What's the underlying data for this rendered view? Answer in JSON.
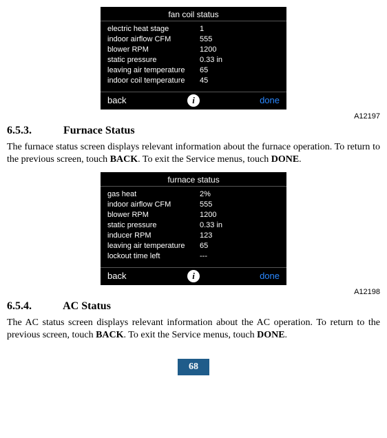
{
  "figure1": {
    "title": "fan coil status",
    "rows": [
      {
        "label": "electric heat stage",
        "value": "1"
      },
      {
        "label": "indoor airflow CFM",
        "value": "555"
      },
      {
        "label": "blower RPM",
        "value": "1200"
      },
      {
        "label": "static pressure",
        "value": "0.33 in"
      },
      {
        "label": "leaving air temperature",
        "value": "65"
      },
      {
        "label": "indoor coil temperature",
        "value": "45"
      }
    ],
    "back": "back",
    "done": "done",
    "caption": "A12197"
  },
  "section1": {
    "number": "6.5.3.",
    "title": "Furnace Status",
    "paragraph": "The furnace status screen displays relevant information about the furnace operation. To return to the previous screen, touch BACK. To exit the Service menus, touch DONE."
  },
  "figure2": {
    "title": "furnace status",
    "rows": [
      {
        "label": "gas heat",
        "value": "2%"
      },
      {
        "label": "indoor airflow CFM",
        "value": "555"
      },
      {
        "label": "blower RPM",
        "value": "1200"
      },
      {
        "label": "static pressure",
        "value": "0.33 in"
      },
      {
        "label": "inducer RPM",
        "value": "123"
      },
      {
        "label": "leaving air temperature",
        "value": "65"
      },
      {
        "label": "lockout time left",
        "value": "---"
      }
    ],
    "back": "back",
    "done": "done",
    "caption": "A12198"
  },
  "section2": {
    "number": "6.5.4.",
    "title": "AC Status",
    "paragraph": "The AC status screen displays relevant information about the AC operation. To return to the previous screen, touch BACK. To exit the Service menus, touch DONE."
  },
  "page_number": "68"
}
